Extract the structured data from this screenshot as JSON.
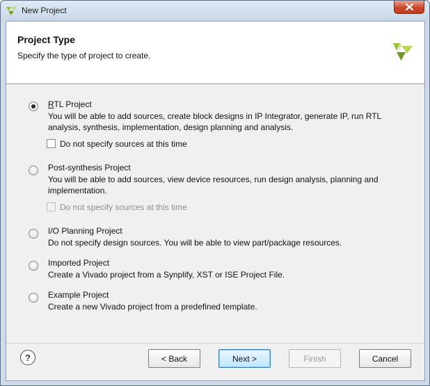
{
  "window": {
    "title": "New Project"
  },
  "header": {
    "title": "Project Type",
    "subtitle": "Specify the type of project to create."
  },
  "options": [
    {
      "label": "RTL Project",
      "selected": true,
      "desc_line1": "You will be able to add sources, create block designs in IP Integrator, generate IP, run RTL",
      "desc_line2": "analysis, synthesis, implementation, design planning and analysis.",
      "checkbox": {
        "label": "Do not specify sources at this time",
        "checked": false,
        "enabled": true
      }
    },
    {
      "label": "Post-synthesis Project",
      "selected": false,
      "desc_line1": "You will be able to add sources, view device resources, run design analysis, planning and",
      "desc_line2": "implementation.",
      "checkbox": {
        "label": "Do not specify sources at this time",
        "checked": false,
        "enabled": false
      }
    },
    {
      "label": "I/O Planning Project",
      "selected": false,
      "desc_line1": "Do not specify design sources. You will be able to view part/package resources."
    },
    {
      "label": "Imported Project",
      "selected": false,
      "desc_line1": "Create a Vivado project from a Synplify, XST or ISE Project File."
    },
    {
      "label": "Example Project",
      "selected": false,
      "desc_line1": "Create a new Vivado project from a predefined template."
    }
  ],
  "footer": {
    "help": "?",
    "back": "< Back",
    "next": "Next >",
    "finish": "Finish",
    "cancel": "Cancel"
  },
  "colors": {
    "accent": "#3c7fb1",
    "logo": "#8db72a"
  }
}
